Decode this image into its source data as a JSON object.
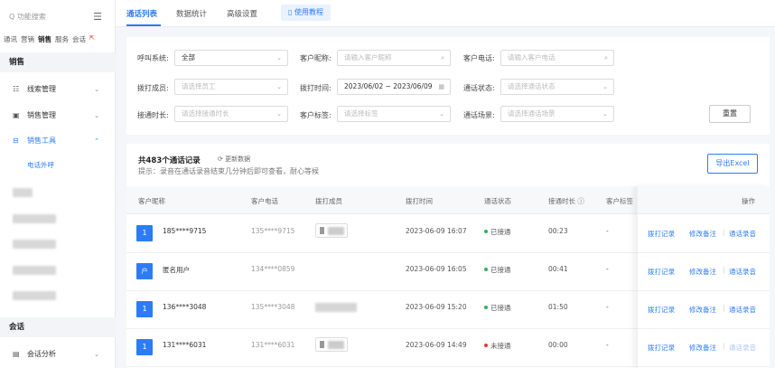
{
  "sidebar": {
    "search_placeholder": "Q 功能搜索",
    "tabs": [
      "通讯",
      "营销",
      "销售",
      "服务",
      "会话"
    ],
    "active_tab_index": 2,
    "sales_header": "销售",
    "items": [
      {
        "label": "线索管理",
        "icon": "funnel-icon"
      },
      {
        "label": "销售管理",
        "icon": "calendar-icon"
      },
      {
        "label": "销售工具",
        "icon": "toolbox-icon",
        "active": true
      }
    ],
    "sub_item": "电话外呼",
    "conversation_header": "会话",
    "bottom_item": {
      "label": "会话分析",
      "icon": "chart-icon"
    }
  },
  "topbar": {
    "tabs": [
      "通话列表",
      "数据统计",
      "高级设置"
    ],
    "active_tab_index": 0,
    "help_label": "使用教程"
  },
  "filters": {
    "row1": [
      {
        "label": "呼叫系统:",
        "value": "全部",
        "type": "select"
      },
      {
        "label": "客户昵称:",
        "placeholder": "请输入客户昵称",
        "type": "search"
      },
      {
        "label": "客户电话:",
        "placeholder": "请输入客户电话",
        "type": "search"
      }
    ],
    "row2": [
      {
        "label": "拨打成员:",
        "placeholder": "请选择员工",
        "type": "select"
      },
      {
        "label": "拨打时间:",
        "value": "2023/06/02 ~ 2023/06/09",
        "type": "date"
      },
      {
        "label": "通话状态:",
        "placeholder": "请选择通话状态",
        "type": "select"
      }
    ],
    "row3": [
      {
        "label": "接通时长:",
        "placeholder": "请选择接通时长",
        "type": "select"
      },
      {
        "label": "客户标签:",
        "placeholder": "请选择标签",
        "type": "select"
      },
      {
        "label": "通话场景:",
        "placeholder": "请选择通话场景",
        "type": "select"
      }
    ],
    "reset_label": "重置"
  },
  "table": {
    "total_text": "共483个通话记录",
    "refresh_text": "⟳ 更新数据",
    "hint": "提示：录音在通话录音结束几分钟后即可查看，耐心等候",
    "export_label": "导出Excel",
    "headers": [
      "客户昵称",
      "客户电话",
      "拨打成员",
      "拨打时间",
      "通话状态",
      "接通时长 ⓘ",
      "客户标签",
      "操作"
    ],
    "rows": [
      {
        "badge": "1",
        "name": "185****9715",
        "phone": "135****9715",
        "time": "2023-06-09 16:07",
        "status": "已接通",
        "status_color": "#2bb55b",
        "duration": "00:23",
        "tag": "-"
      },
      {
        "badge": "户",
        "name": "匿名用户",
        "phone": "134****0859",
        "time": "2023-06-09 16:05",
        "status": "已接通",
        "status_color": "#2bb55b",
        "duration": "00:41",
        "tag": "-"
      },
      {
        "badge": "1",
        "name": "136****3048",
        "phone": "135****3048",
        "time": "2023-06-09 15:20",
        "status": "已接通",
        "status_color": "#2bb55b",
        "duration": "01:50",
        "tag": "-"
      },
      {
        "badge": "1",
        "name": "131****6031",
        "phone": "131****6031",
        "time": "2023-06-09 14:49",
        "status": "未接通",
        "status_color": "#e5383b",
        "duration": "00:00",
        "tag": "-"
      }
    ],
    "ops": [
      "拨打记录",
      "修改备注",
      "通话录音"
    ]
  }
}
